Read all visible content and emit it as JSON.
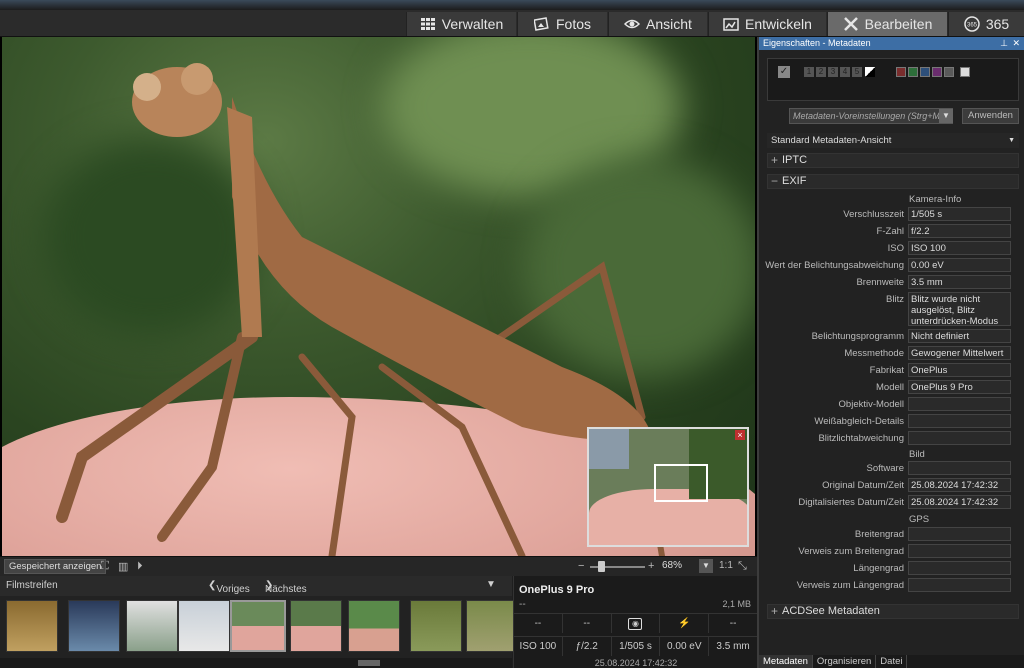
{
  "modes": [
    {
      "label": "Verwalten",
      "icon": "grid-icon"
    },
    {
      "label": "Fotos",
      "icon": "photos-icon"
    },
    {
      "label": "Ansicht",
      "icon": "eye-icon"
    },
    {
      "label": "Entwickeln",
      "icon": "develop-icon"
    },
    {
      "label": "Bearbeiten",
      "icon": "tools-icon",
      "active": true
    },
    {
      "label": "365",
      "icon": "cloud-365-icon"
    }
  ],
  "viewer": {
    "saved_button": "Gespeichert anzeigen",
    "zoom": "68%",
    "one_to_one": "1:1"
  },
  "filmstrip": {
    "title": "Filmstreifen",
    "prev": "Voriges",
    "next": "Nächstes"
  },
  "info": {
    "camera": "OnePlus 9 Pro",
    "lens": "--",
    "size": "2,1 MB",
    "row1": [
      "--",
      "--",
      "",
      "",
      "--"
    ],
    "row2": [
      "ISO 100",
      "ƒ/2.2",
      "1/505 s",
      "0.00 eV",
      "3.5 mm"
    ],
    "date": "25.08.2024 17:42:32"
  },
  "props": {
    "title": "Eigenschaften - Metadaten",
    "ratings": [
      "1",
      "2",
      "3",
      "4",
      "5"
    ],
    "colors": [
      "#7a2d2d",
      "#2d6e3a",
      "#2d4f7a",
      "#6a2d6e",
      "#5a5a5a",
      "#dddddd"
    ],
    "preset_placeholder": "Metadaten-Voreinstellungen (Strg+M)",
    "apply": "Anwenden",
    "view": "Standard Metadaten-Ansicht",
    "sections": {
      "iptc": "IPTC",
      "exif": "EXIF",
      "acdsee": "ACDSee Metadaten"
    },
    "group_camera": "Kamera-Info",
    "group_image": "Bild",
    "group_gps": "GPS",
    "fields": [
      {
        "label": "Verschlusszeit",
        "value": "1/505 s"
      },
      {
        "label": "F-Zahl",
        "value": "f/2.2"
      },
      {
        "label": "ISO",
        "value": "ISO 100"
      },
      {
        "label": "Wert der Belichtungsabweichung",
        "value": "0.00 eV"
      },
      {
        "label": "Brennweite",
        "value": "3.5 mm"
      },
      {
        "label": "Blitz",
        "value": "Blitz wurde nicht ausgelöst, Blitz unterdrücken-Modus"
      },
      {
        "label": "Belichtungsprogramm",
        "value": "Nicht definiert"
      },
      {
        "label": "Messmethode",
        "value": "Gewogener Mittelwert"
      },
      {
        "label": "Fabrikat",
        "value": "OnePlus"
      },
      {
        "label": "Modell",
        "value": "OnePlus 9 Pro"
      },
      {
        "label": "Objektiv-Modell",
        "value": ""
      },
      {
        "label": "Weißabgleich-Details",
        "value": ""
      },
      {
        "label": "Blitzlichtabweichung",
        "value": ""
      },
      {
        "label": "Software",
        "value": ""
      },
      {
        "label": "Original Datum/Zeit",
        "value": "25.08.2024 17:42:32"
      },
      {
        "label": "Digitalisiertes Datum/Zeit",
        "value": "25.08.2024 17:42:32"
      },
      {
        "label": "Breitengrad",
        "value": ""
      },
      {
        "label": "Verweis zum Breitengrad",
        "value": ""
      },
      {
        "label": "Längengrad",
        "value": ""
      },
      {
        "label": "Verweis zum Längengrad",
        "value": ""
      }
    ],
    "tabs": [
      "Metadaten",
      "Organisieren",
      "Datei"
    ]
  }
}
